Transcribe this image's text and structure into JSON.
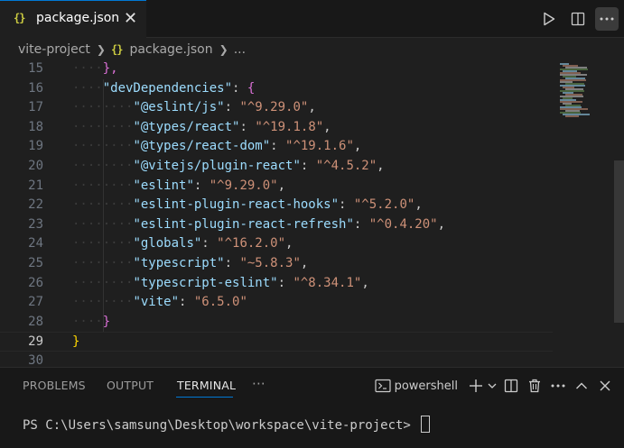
{
  "tab": {
    "icon": "{}",
    "label": "package.json",
    "close": "✕"
  },
  "breadcrumb": {
    "folder": "vite-project",
    "icon": "{}",
    "file": "package.json",
    "more": "..."
  },
  "editor": {
    "current_line": 29,
    "lines": [
      {
        "n": "15",
        "indent": 4,
        "parts": [
          [
            "b2",
            "},"
          ]
        ]
      },
      {
        "n": "16",
        "indent": 4,
        "parts": [
          [
            "k",
            "\"devDependencies\""
          ],
          [
            "p",
            ": "
          ],
          [
            "b2",
            "{"
          ]
        ]
      },
      {
        "n": "17",
        "indent": 8,
        "parts": [
          [
            "k",
            "\"@eslint/js\""
          ],
          [
            "p",
            ": "
          ],
          [
            "s",
            "\"^9.29.0\""
          ],
          [
            "p",
            ","
          ]
        ]
      },
      {
        "n": "18",
        "indent": 8,
        "parts": [
          [
            "k",
            "\"@types/react\""
          ],
          [
            "p",
            ": "
          ],
          [
            "s",
            "\"^19.1.8\""
          ],
          [
            "p",
            ","
          ]
        ]
      },
      {
        "n": "19",
        "indent": 8,
        "parts": [
          [
            "k",
            "\"@types/react-dom\""
          ],
          [
            "p",
            ": "
          ],
          [
            "s",
            "\"^19.1.6\""
          ],
          [
            "p",
            ","
          ]
        ]
      },
      {
        "n": "20",
        "indent": 8,
        "parts": [
          [
            "k",
            "\"@vitejs/plugin-react\""
          ],
          [
            "p",
            ": "
          ],
          [
            "s",
            "\"^4.5.2\""
          ],
          [
            "p",
            ","
          ]
        ]
      },
      {
        "n": "21",
        "indent": 8,
        "parts": [
          [
            "k",
            "\"eslint\""
          ],
          [
            "p",
            ": "
          ],
          [
            "s",
            "\"^9.29.0\""
          ],
          [
            "p",
            ","
          ]
        ]
      },
      {
        "n": "22",
        "indent": 8,
        "parts": [
          [
            "k",
            "\"eslint-plugin-react-hooks\""
          ],
          [
            "p",
            ": "
          ],
          [
            "s",
            "\"^5.2.0\""
          ],
          [
            "p",
            ","
          ]
        ]
      },
      {
        "n": "23",
        "indent": 8,
        "parts": [
          [
            "k",
            "\"eslint-plugin-react-refresh\""
          ],
          [
            "p",
            ": "
          ],
          [
            "s",
            "\"^0.4.20\""
          ],
          [
            "p",
            ","
          ]
        ]
      },
      {
        "n": "24",
        "indent": 8,
        "parts": [
          [
            "k",
            "\"globals\""
          ],
          [
            "p",
            ": "
          ],
          [
            "s",
            "\"^16.2.0\""
          ],
          [
            "p",
            ","
          ]
        ]
      },
      {
        "n": "25",
        "indent": 8,
        "parts": [
          [
            "k",
            "\"typescript\""
          ],
          [
            "p",
            ": "
          ],
          [
            "s",
            "\"~5.8.3\""
          ],
          [
            "p",
            ","
          ]
        ]
      },
      {
        "n": "26",
        "indent": 8,
        "parts": [
          [
            "k",
            "\"typescript-eslint\""
          ],
          [
            "p",
            ": "
          ],
          [
            "s",
            "\"^8.34.1\""
          ],
          [
            "p",
            ","
          ]
        ]
      },
      {
        "n": "27",
        "indent": 8,
        "parts": [
          [
            "k",
            "\"vite\""
          ],
          [
            "p",
            ": "
          ],
          [
            "s",
            "\"6.5.0\""
          ]
        ]
      },
      {
        "n": "28",
        "indent": 4,
        "parts": [
          [
            "b2",
            "}"
          ]
        ]
      },
      {
        "n": "29",
        "indent": 0,
        "parts": [
          [
            "b1",
            "}"
          ]
        ]
      },
      {
        "n": "30",
        "indent": 0,
        "parts": []
      }
    ]
  },
  "panel": {
    "tabs": [
      "PROBLEMS",
      "OUTPUT",
      "TERMINAL"
    ],
    "active_tab": "TERMINAL",
    "more": "···",
    "shell": "powershell",
    "prompt": "PS C:\\Users\\samsung\\Desktop\\workspace\\vite-project> "
  },
  "colors": {
    "accent": "#0078d4",
    "json_icon": "#cbcb41",
    "key": "#9cdcfe",
    "string": "#ce9178"
  }
}
